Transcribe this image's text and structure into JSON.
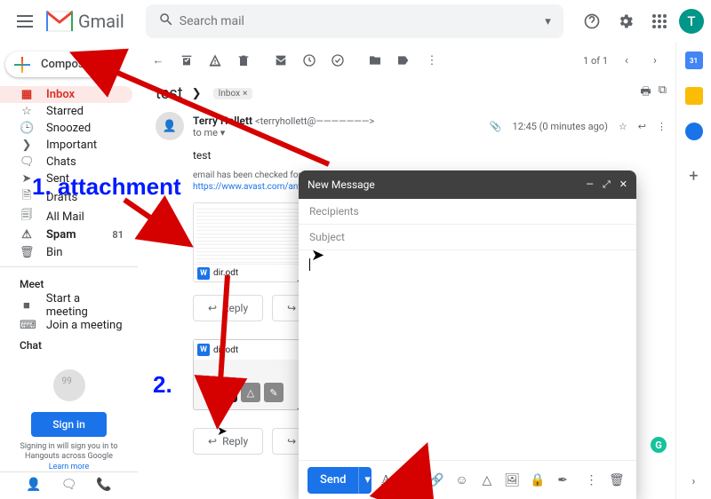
{
  "header": {
    "app_name": "Gmail",
    "search_placeholder": "Search mail",
    "avatar_initial": "T"
  },
  "compose_btn": "Compose",
  "sidebar": {
    "items": [
      {
        "icon": "inbox-icon",
        "glyph": "▦",
        "label": "Inbox",
        "active": true
      },
      {
        "icon": "star-icon",
        "glyph": "☆",
        "label": "Starred"
      },
      {
        "icon": "clock-icon",
        "glyph": "🕒",
        "label": "Snoozed"
      },
      {
        "icon": "important-icon",
        "glyph": "❯",
        "label": "Important"
      },
      {
        "icon": "chat-icon",
        "glyph": "🗨",
        "label": "Chats"
      },
      {
        "icon": "sent-icon",
        "glyph": "➤",
        "label": "Sent"
      },
      {
        "icon": "draft-icon",
        "glyph": "🗎",
        "label": "Drafts"
      },
      {
        "icon": "allmail-icon",
        "glyph": "🗐",
        "label": "All Mail"
      },
      {
        "icon": "spam-icon",
        "glyph": "⚠",
        "label": "Spam",
        "bold": true,
        "count": "81"
      },
      {
        "icon": "bin-icon",
        "glyph": "🗑",
        "label": "Bin"
      }
    ],
    "meet_heading": "Meet",
    "meet": [
      {
        "icon": "video-icon",
        "glyph": "■",
        "label": "Start a meeting"
      },
      {
        "icon": "keyboard-icon",
        "glyph": "⌨",
        "label": "Join a meeting"
      }
    ],
    "chat_heading": "Chat",
    "signin": "Sign in",
    "signin_sub": "Signing in will sign you in to Hangouts across Google",
    "learn_more": "Learn more"
  },
  "toolbar": {
    "page_count": "1 of 1"
  },
  "email": {
    "subject": "test",
    "label_chip": "Inbox",
    "sender_name": "Terry Hollett",
    "sender_email": "<terryhollett@———————>",
    "to_line": "to me ▾",
    "time": "12:45 (0 minutes ago)",
    "body": "test",
    "avast_text": "email has been checked for viruses by A",
    "avast_link": "https://www.avast.com/antivirus",
    "attach_name": "dir.odt",
    "reply": "Reply",
    "forward": "Forward"
  },
  "compose": {
    "title": "New Message",
    "recipients": "Recipients",
    "subject": "Subject",
    "send": "Send"
  },
  "rightpanel": {
    "cal": "31"
  },
  "annotations": {
    "a1": "1. attachment",
    "a2": "2."
  }
}
